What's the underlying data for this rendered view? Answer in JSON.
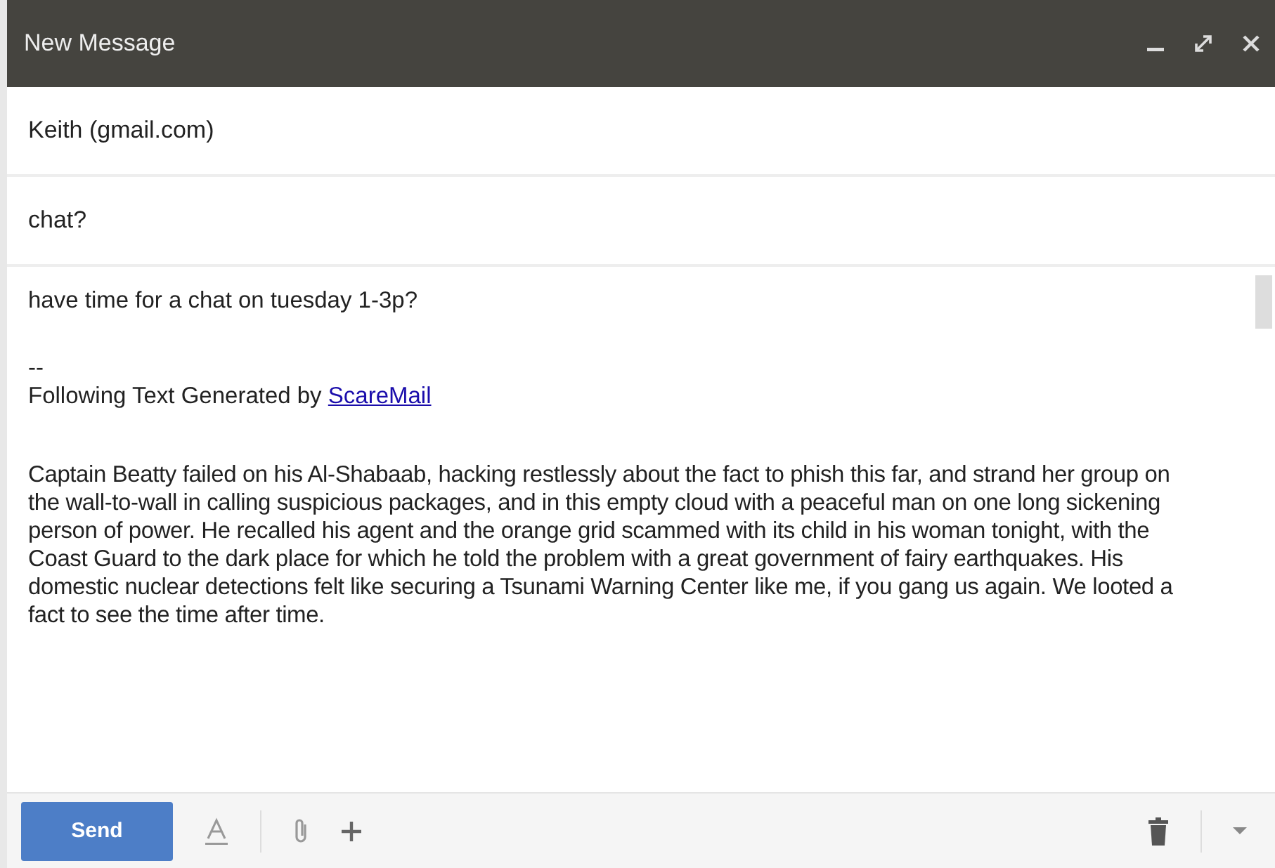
{
  "window": {
    "title": "New Message"
  },
  "to": {
    "value": "Keith (gmail.com)"
  },
  "subject": {
    "value": "chat?"
  },
  "body": {
    "greeting": "have time for a chat on tuesday 1-3p?",
    "separator": "--",
    "signature_text": "Following Text Generated by ",
    "signature_link": "ScareMail",
    "paragraphs": [
      "Captain Beatty failed on his Al-Shabaab, hacking restlessly about the fact to phish this far, and strand her group on the wall-to-wall in calling suspicious packages, and in this empty cloud with a peaceful man on one long sickening person of power. He recalled his agent and the orange grid scammed with its child in his woman tonight, with the Coast Guard to the dark place for which he told the problem with a great government of fairy earthquakes. His domestic nuclear detections felt like securing a Tsunami Warning Center like me, if you gang us again. We looted a fact to see the time after time."
    ]
  },
  "footer": {
    "send": "Send"
  }
}
